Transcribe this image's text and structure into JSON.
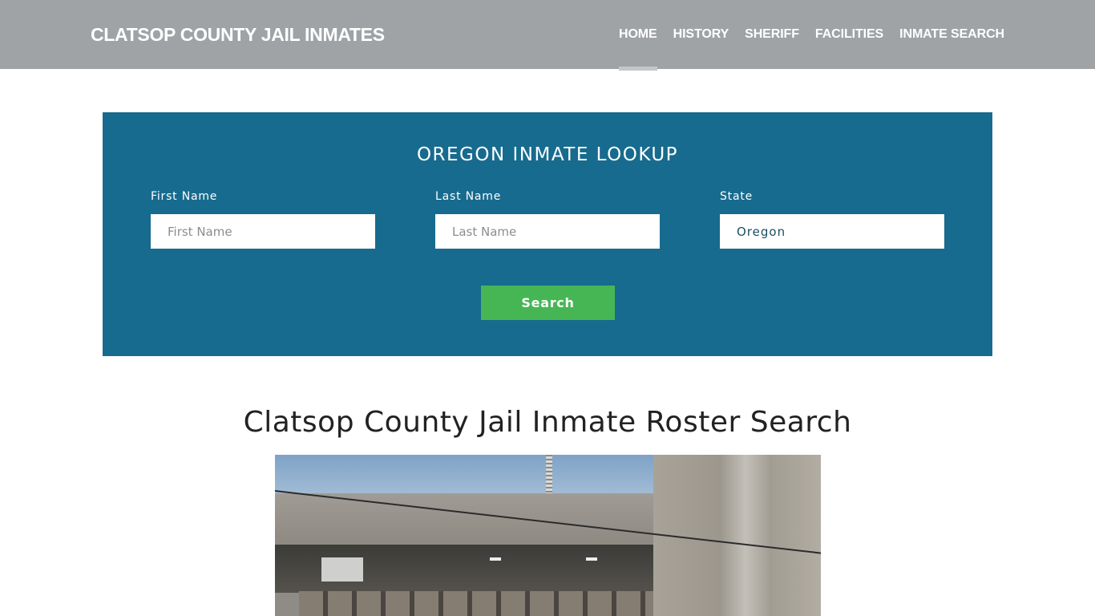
{
  "header": {
    "brand": "CLATSOP COUNTY JAIL INMATES",
    "nav": [
      {
        "label": "HOME",
        "active": true
      },
      {
        "label": "HISTORY",
        "active": false
      },
      {
        "label": "SHERIFF",
        "active": false
      },
      {
        "label": "FACILITIES",
        "active": false
      },
      {
        "label": "INMATE SEARCH",
        "active": false
      }
    ]
  },
  "lookup": {
    "title": "OREGON INMATE LOOKUP",
    "first_name": {
      "label": "First Name",
      "placeholder": "First Name",
      "value": ""
    },
    "last_name": {
      "label": "Last Name",
      "placeholder": "Last Name",
      "value": ""
    },
    "state": {
      "label": "State",
      "value": "Oregon"
    },
    "search_label": "Search"
  },
  "main": {
    "title": "Clatsop County Jail Inmate Roster Search",
    "image_alt": "Clatsop County Jail building exterior"
  },
  "colors": {
    "header_bg": "#9fa3a6",
    "lookup_bg": "#176b8e",
    "search_button": "#46b655"
  }
}
